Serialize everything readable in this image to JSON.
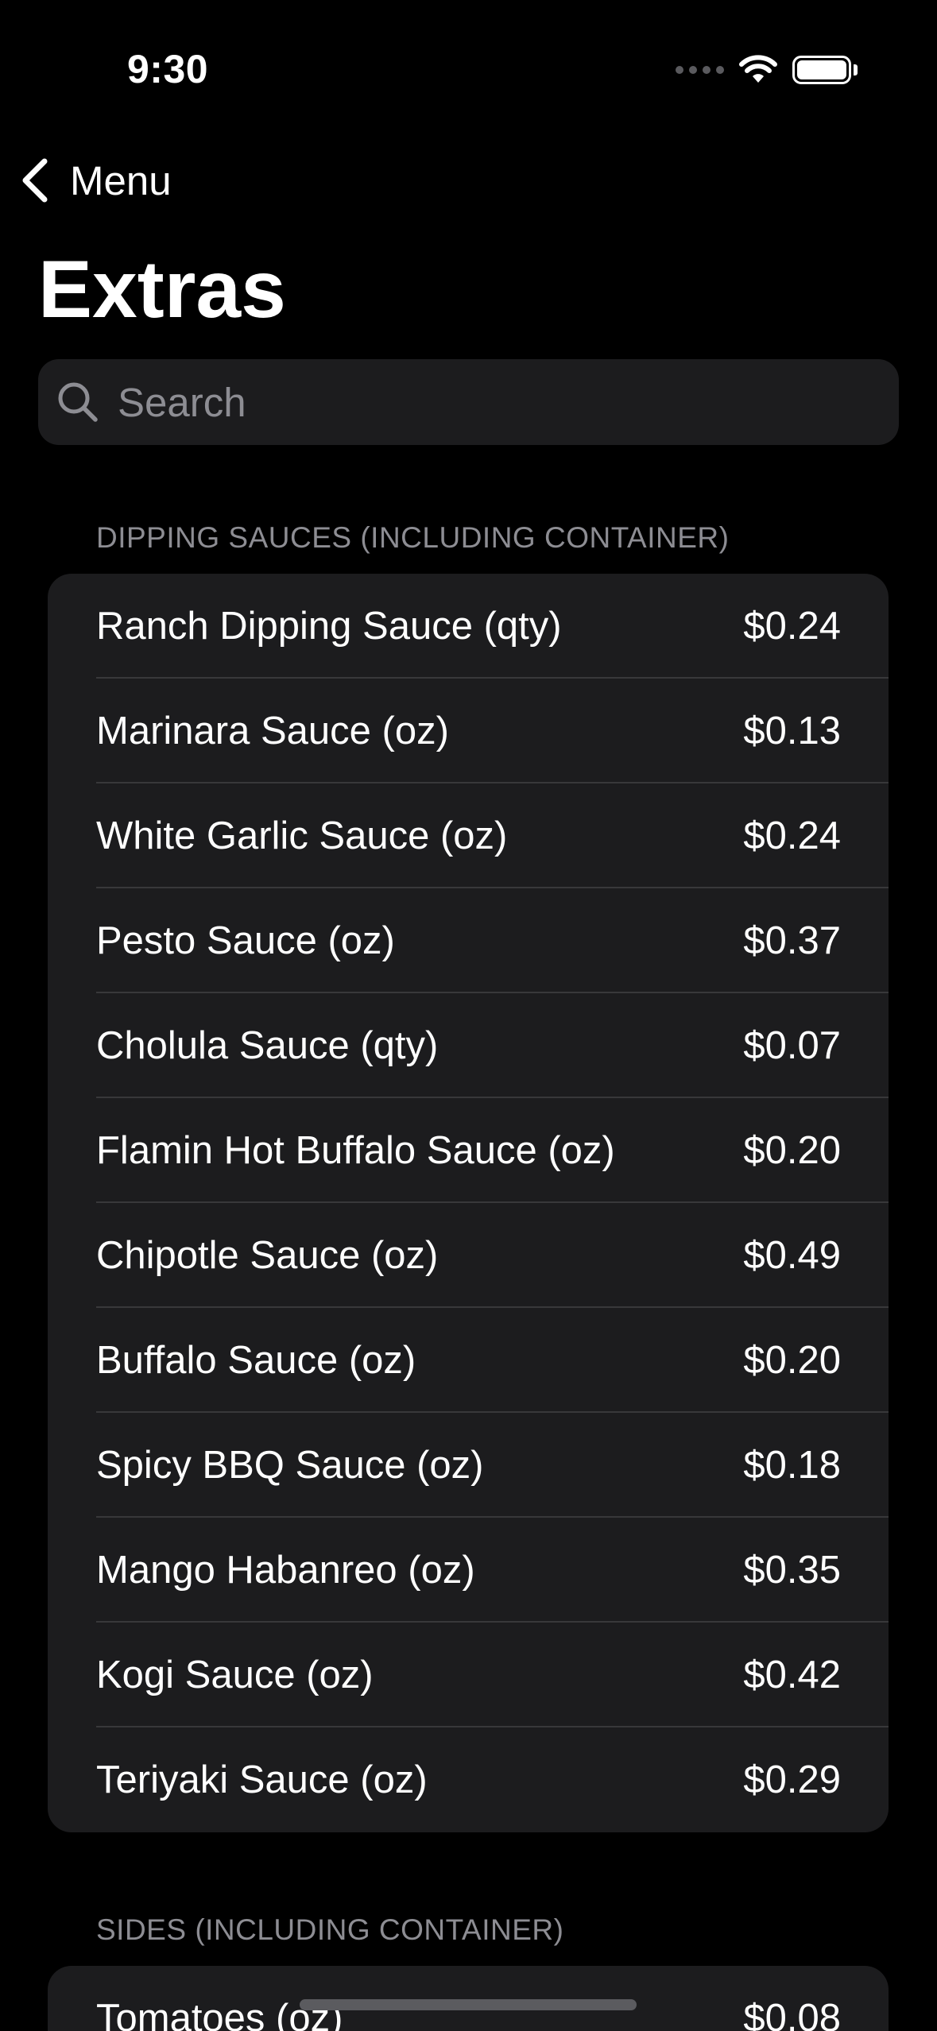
{
  "status_bar": {
    "time": "9:30"
  },
  "nav": {
    "back_label": "Menu",
    "title": "Extras"
  },
  "search": {
    "placeholder": "Search",
    "value": ""
  },
  "sections": [
    {
      "header": "DIPPING SAUCES (INCLUDING CONTAINER)",
      "items": [
        {
          "label": "Ranch Dipping Sauce (qty)",
          "price": "$0.24"
        },
        {
          "label": "Marinara Sauce (oz)",
          "price": "$0.13"
        },
        {
          "label": "White Garlic Sauce (oz)",
          "price": "$0.24"
        },
        {
          "label": "Pesto Sauce (oz)",
          "price": "$0.37"
        },
        {
          "label": "Cholula Sauce (qty)",
          "price": "$0.07"
        },
        {
          "label": "Flamin Hot Buffalo Sauce (oz)",
          "price": "$0.20"
        },
        {
          "label": "Chipotle Sauce (oz)",
          "price": "$0.49"
        },
        {
          "label": "Buffalo Sauce (oz)",
          "price": "$0.20"
        },
        {
          "label": "Spicy BBQ Sauce (oz)",
          "price": "$0.18"
        },
        {
          "label": "Mango Habanreo (oz)",
          "price": "$0.35"
        },
        {
          "label": "Kogi Sauce (oz)",
          "price": "$0.42"
        },
        {
          "label": "Teriyaki Sauce (oz)",
          "price": "$0.29"
        }
      ]
    },
    {
      "header": "SIDES (INCLUDING CONTAINER)",
      "items": [
        {
          "label": "Tomatoes (oz)",
          "price": "$0.08"
        }
      ]
    }
  ],
  "colors": {
    "background": "#000000",
    "card": "#1c1c1e",
    "separator": "#38383a",
    "secondary_text": "#8d8d93"
  },
  "icons": {
    "back": "chevron-left-icon",
    "search": "magnifying-glass-icon",
    "wifi": "wifi-icon",
    "battery": "battery-icon",
    "signal": "cellular-signal-icon"
  }
}
